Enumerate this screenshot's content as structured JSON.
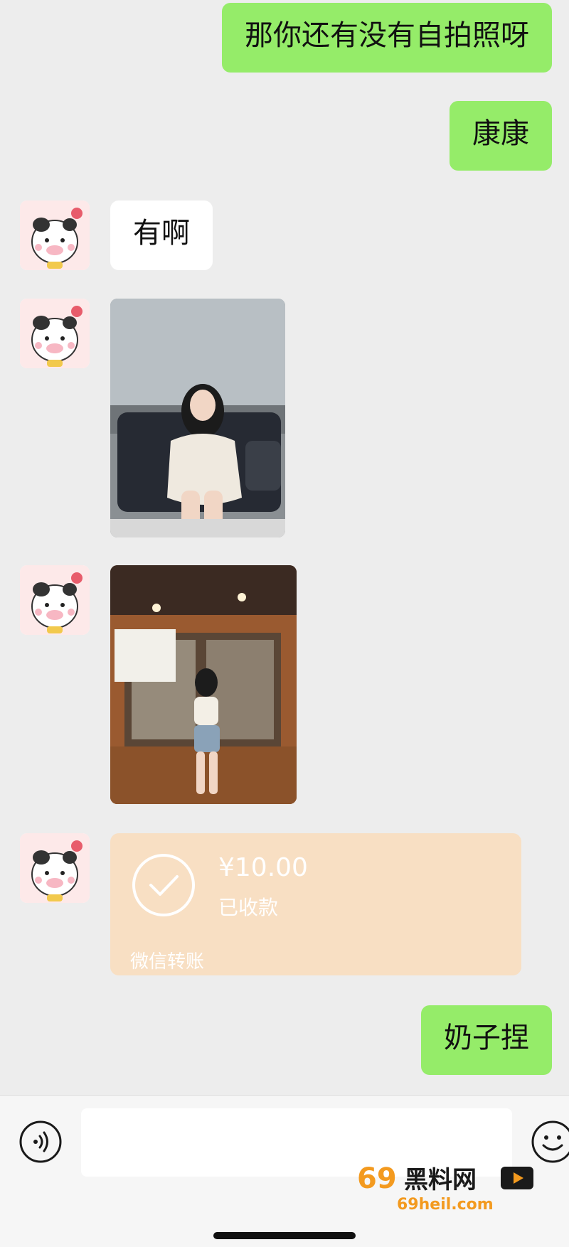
{
  "messages": {
    "sent_1": "那你还有没有自拍照呀",
    "sent_2": "康康",
    "received_1": "有啊",
    "sent_3": "奶子捏"
  },
  "transfer": {
    "amount": "¥10.00",
    "status": "已收款",
    "label": "微信转账"
  },
  "input_bar": {
    "value": "",
    "voice_icon": "voice-icon",
    "emoji_icon": "emoji-icon"
  },
  "watermark": {
    "logo_text": "69黑料网",
    "url_text": "69heil.com"
  },
  "colors": {
    "background": "#ededed",
    "sent_bubble": "#95ec69",
    "received_bubble": "#ffffff",
    "transfer_card": "#f8dfc3"
  }
}
